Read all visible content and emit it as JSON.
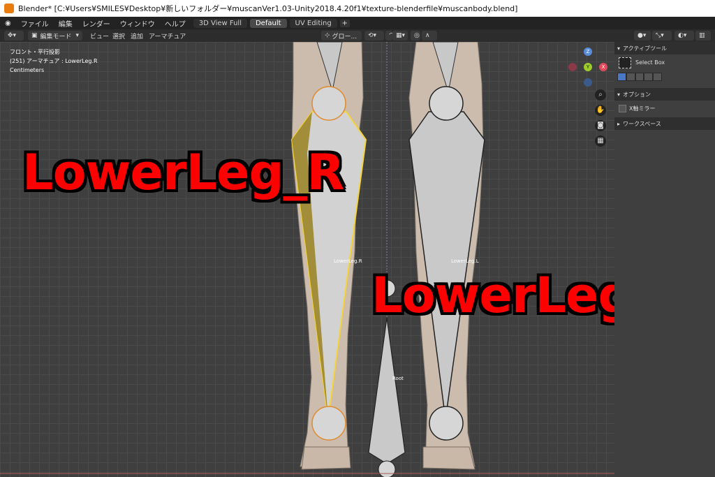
{
  "window": {
    "title": "Blender* [C:¥Users¥SMILES¥Desktop¥新しいフォルダー¥muscanVer1.03-Unity2018.4.20f1¥texture-blenderfile¥muscanbody.blend]"
  },
  "menu": {
    "items": [
      "ファイル",
      "編集",
      "レンダー",
      "ウィンドウ",
      "ヘルプ"
    ],
    "workspace_tabs": [
      "3D View Full",
      "Default",
      "UV Editing"
    ],
    "plus": "+"
  },
  "header": {
    "mode": "編集モード",
    "view": "ビュー",
    "select": "選択",
    "add": "追加",
    "armature": "アーマチュア",
    "orientation": "グロー..."
  },
  "viewport_info": {
    "view_name": "フロント・平行投影",
    "object": "(251) アーマチュア : LowerLeg.R",
    "units": "Centimeters"
  },
  "bones": {
    "right_name": "LowerLeg.R",
    "left_name": "LowerLeg.L",
    "root_name": "Root"
  },
  "overlay_labels": {
    "right": "LowerLeg_R",
    "left": "LowerLeg_L"
  },
  "gizmo": {
    "z": "Z",
    "y": "Y",
    "x": "X"
  },
  "right_panel": {
    "active_tool_header": "アクティブツール",
    "tool_name": "Select Box",
    "options_header": "オプション",
    "x_mirror": "X軸ミラー",
    "workspace_header": "ワークスペース"
  },
  "colors": {
    "selected_bone_outline": "#f5d33a",
    "overlay_text": "#ff0000",
    "active_joint": "#e08a2c"
  }
}
